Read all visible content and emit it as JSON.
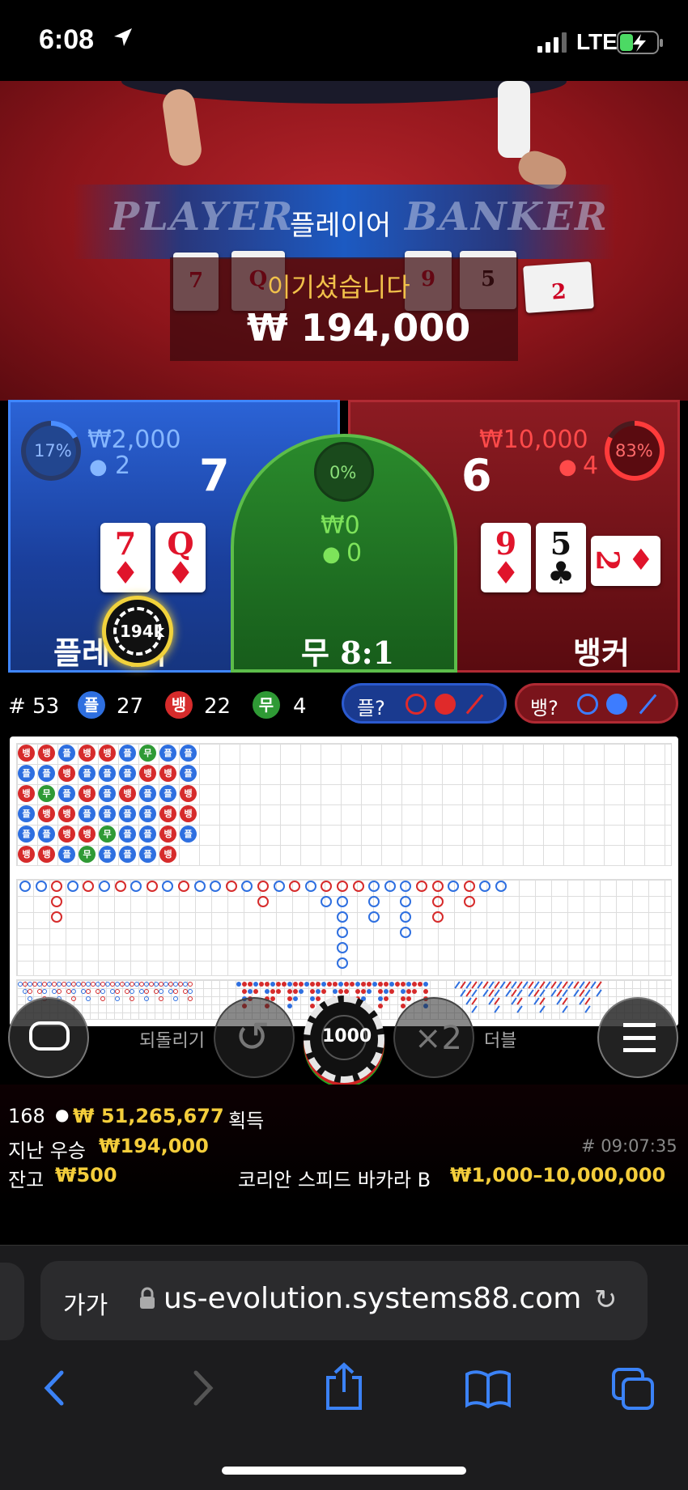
{
  "status_bar": {
    "time": "6:08",
    "network": "LTE"
  },
  "video": {
    "player_ghost": "PLAYER",
    "banker_ghost": "BANKER",
    "banner_label": "플레이어",
    "win_message": "이기셨습니다",
    "win_amount": "₩ 194,000"
  },
  "player_panel": {
    "percent": "17%",
    "bet": "₩2,000",
    "bettors": "2",
    "score": "7",
    "cards": [
      {
        "rank": "7",
        "suit": "♦"
      },
      {
        "rank": "Q",
        "suit": "♦"
      }
    ],
    "label": "플레이어",
    "chip": "194k"
  },
  "tie_panel": {
    "percent": "0%",
    "bet": "₩0",
    "bettors": "0",
    "label": "무 8:1"
  },
  "banker_panel": {
    "percent": "83%",
    "bet": "₩10,000",
    "bettors": "4",
    "score": "6",
    "cards": [
      {
        "rank": "9",
        "suit": "♦"
      },
      {
        "rank": "5",
        "suit": "♣"
      },
      {
        "rank": "2",
        "suit": "♦"
      }
    ],
    "label": "뱅커"
  },
  "score_bar": {
    "round": "# 53",
    "player_letter": "플",
    "player_count": "27",
    "banker_letter": "뱅",
    "banker_count": "22",
    "tie_letter": "무",
    "tie_count": "4",
    "player_ask": "플?",
    "banker_ask": "뱅?"
  },
  "bead_road": [
    [
      "뱅",
      "플",
      "뱅",
      "플",
      "플",
      "뱅"
    ],
    [
      "뱅",
      "플",
      "무",
      "뱅",
      "플",
      "뱅"
    ],
    [
      "플",
      "뱅",
      "플",
      "뱅",
      "뱅",
      "플"
    ],
    [
      "뱅",
      "플",
      "뱅",
      "플",
      "뱅",
      "무"
    ],
    [
      "뱅",
      "플",
      "플",
      "플",
      "무",
      "플"
    ],
    [
      "플",
      "플",
      "뱅",
      "플",
      "플",
      "플"
    ],
    [
      "무",
      "뱅",
      "플",
      "플",
      "플",
      "플"
    ],
    [
      "플",
      "뱅",
      "플",
      "뱅",
      "뱅",
      "뱅"
    ],
    [
      "플",
      "플",
      "뱅",
      "뱅",
      "플",
      ""
    ]
  ],
  "controls": {
    "undo_label": "되돌리기",
    "chip_value": "1000",
    "double_symbol": "×2",
    "double_label": "더블"
  },
  "info": {
    "players": "168",
    "total_won": "₩ 51,265,677",
    "won_label": "획득",
    "last_win_label": "지난 우승",
    "last_win": "₩194,000",
    "timestamp": "# 09:07:35",
    "balance_label": "잔고",
    "balance": "₩500",
    "table_name": "코리안 스피드 바카라 B",
    "limits": "₩1,000–10,000,000"
  },
  "browser": {
    "text_size": "가가",
    "url": "us-evolution.systems88.com"
  },
  "colors": {
    "player": "#2e6fe0",
    "banker": "#d62b2b",
    "tie": "#2f9a35",
    "gold": "#f4cd3b"
  }
}
